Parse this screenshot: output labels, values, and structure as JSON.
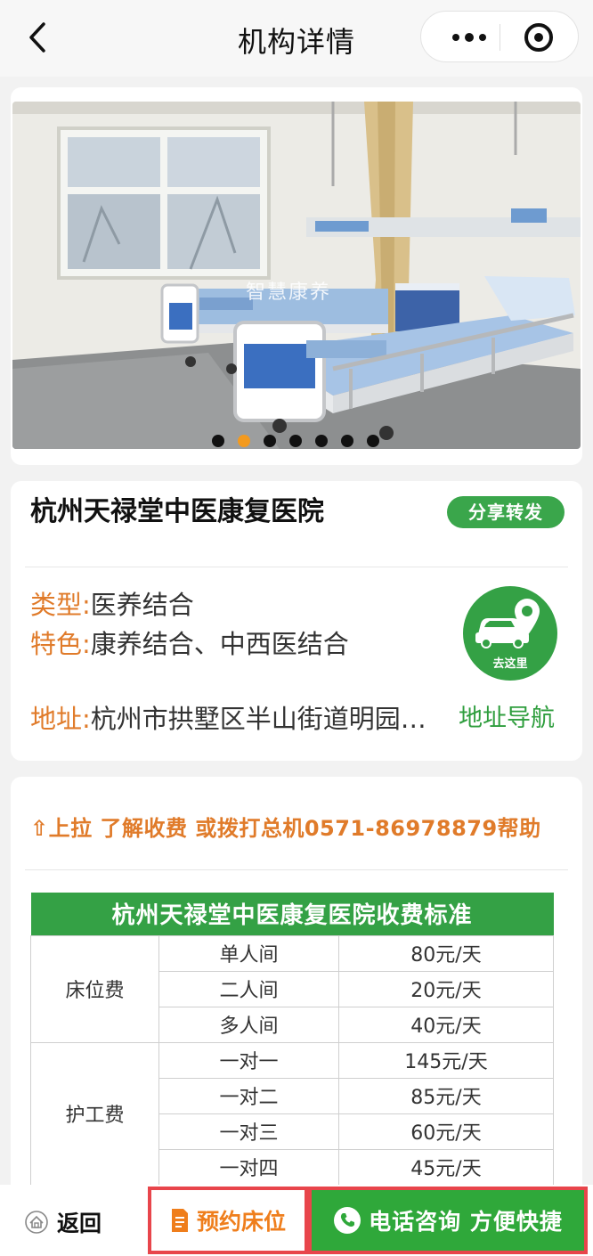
{
  "nav": {
    "title": "机构详情"
  },
  "banner": {
    "watermark": "智慧康养",
    "slide_count": 7,
    "active_slide": 1
  },
  "institution": {
    "name": "杭州天禄堂中医康复医院",
    "share_label": "分享转发",
    "type_label": "类型:",
    "type_value": "医养结合",
    "feature_label": "特色:",
    "feature_value": "康养结合、中西医结合",
    "address_label": "地址:",
    "address_value": "杭州市拱墅区半山街道明园…",
    "go_here_label": "去这里",
    "address_nav_label": "地址导航"
  },
  "fees": {
    "hint": "⇧上拉 了解收费 或拨打总机0571-86978879帮助",
    "table_title": "杭州天禄堂中医康复医院收费标准",
    "groups": [
      {
        "category": "床位费",
        "rows": [
          {
            "item": "单人间",
            "price": "80元/天"
          },
          {
            "item": "二人间",
            "price": "20元/天"
          },
          {
            "item": "多人间",
            "price": "40元/天"
          }
        ]
      },
      {
        "category": "护工费",
        "rows": [
          {
            "item": "一对一",
            "price": "145元/天"
          },
          {
            "item": "一对二",
            "price": "85元/天"
          },
          {
            "item": "一对三",
            "price": "60元/天"
          },
          {
            "item": "一对四",
            "price": "45元/天"
          }
        ]
      }
    ]
  },
  "bottom_bar": {
    "back_label": "返回",
    "reserve_label": "预约床位",
    "call_label": "电话咨询 方便快捷"
  },
  "colors": {
    "accent_green": "#34a145",
    "accent_orange": "#e07b2a",
    "highlight_red": "#e8454b"
  }
}
